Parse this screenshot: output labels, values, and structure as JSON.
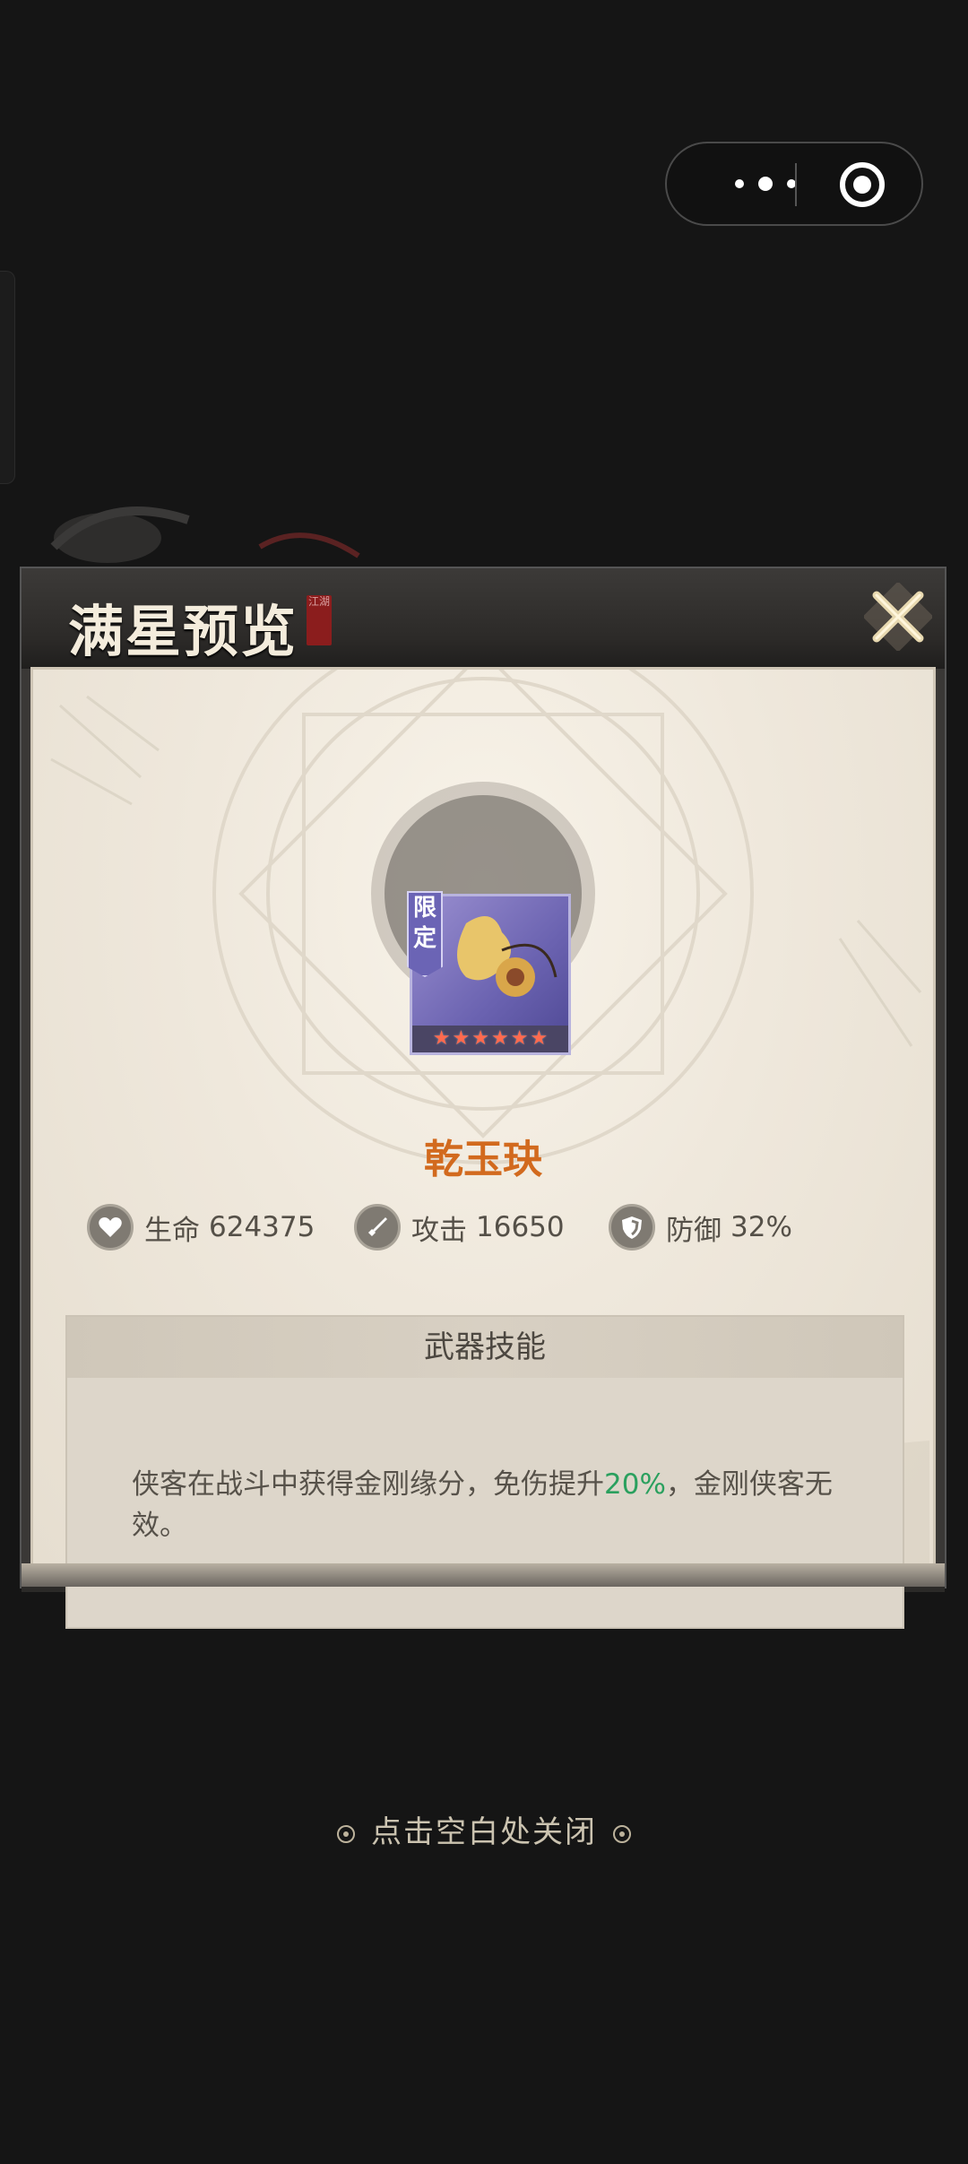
{
  "capsule": {
    "more_icon": "more-dots-icon",
    "close_icon": "target-circle-icon"
  },
  "panel": {
    "title": "满星预览",
    "seal_text": "江湖",
    "close_icon": "close-x-icon"
  },
  "item": {
    "badge": "限定",
    "name": "乾玉玦",
    "stars": 6
  },
  "stats": [
    {
      "icon": "heart-icon",
      "label": "生命",
      "value": "624375"
    },
    {
      "icon": "sword-icon",
      "label": "攻击",
      "value": "16650"
    },
    {
      "icon": "shield-icon",
      "label": "防御",
      "value": "32%"
    }
  ],
  "skill": {
    "heading": "武器技能",
    "text_before": "侠客在战斗中获得金刚缘分，免伤提升",
    "highlight": "20%",
    "text_after": "，金刚侠客无效。",
    "highlight_color": "#2aa05e"
  },
  "footer": {
    "hint": "点击空白处关闭"
  },
  "colors": {
    "background": "#151515",
    "item_name": "#d26a1e",
    "parchment": "#efe8dc"
  }
}
